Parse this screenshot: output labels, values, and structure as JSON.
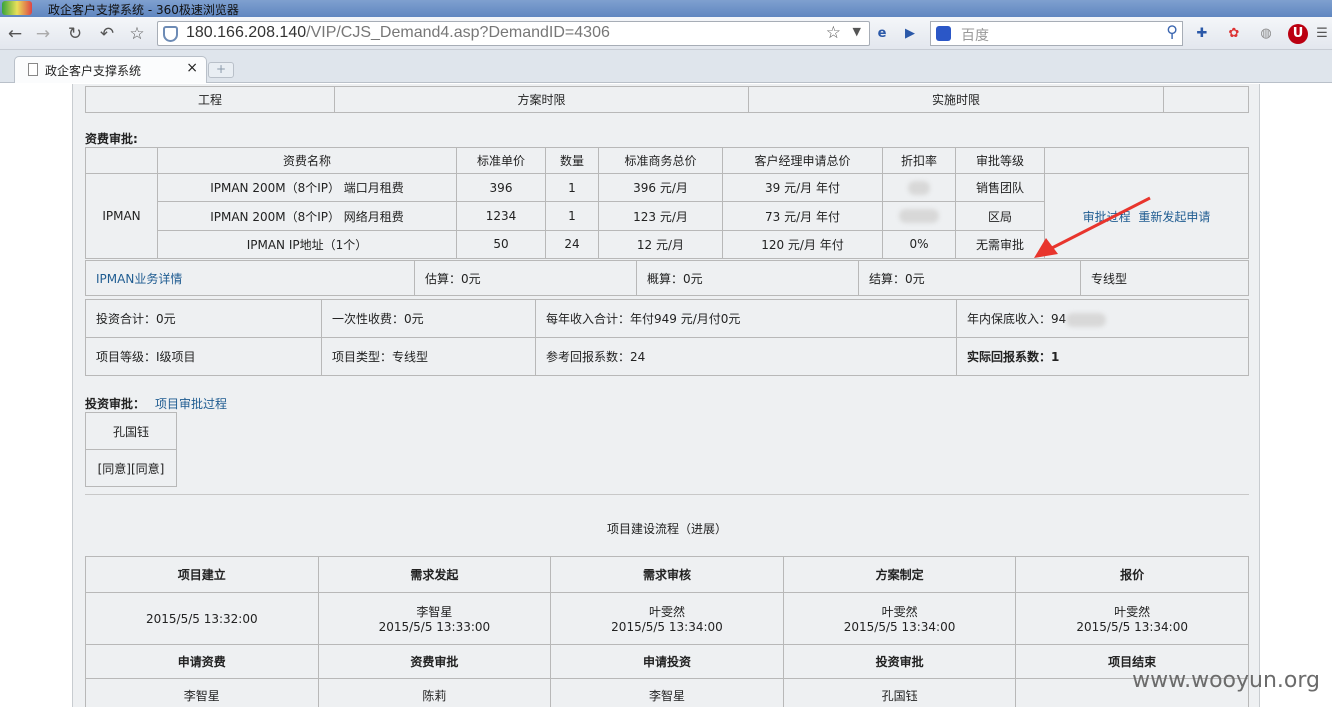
{
  "window": {
    "title": "政企客户支撑系统 - 360极速浏览器"
  },
  "toolbar": {
    "url_host": "180.166.208.140",
    "url_path": "/VIP/CJS_Demand4.asp?DemandID=4306",
    "search_placeholder": "百度"
  },
  "tab": {
    "label": "政企客户支撑系统"
  },
  "top_row": [
    "工程",
    "方案时限",
    "实施时限"
  ],
  "fee": {
    "section_label": "资费审批:",
    "headers": [
      "资费名称",
      "标准单价",
      "数量",
      "标准商务总价",
      "客户经理申请总价",
      "折扣率",
      "审批等级"
    ],
    "group": "IPMAN",
    "rows": [
      {
        "name": "IPMAN 200M（8个IP） 端口月租费",
        "unit": "396",
        "qty": "1",
        "std_total": "396 元/月",
        "mgr_total": "39 元/月 年付",
        "discount": "",
        "level": "销售团队"
      },
      {
        "name": "IPMAN 200M（8个IP） 网络月租费",
        "unit": "1234",
        "qty": "1",
        "std_total": "123 元/月",
        "mgr_total": "73 元/月 年付",
        "discount": "",
        "level": "区局"
      },
      {
        "name": "IPMAN IP地址（1个）",
        "unit": "50",
        "qty": "24",
        "std_total": "12 元/月",
        "mgr_total": "120 元/月 年付",
        "discount": "0%",
        "level": "无需审批"
      }
    ],
    "link_process": "审批过程",
    "link_reapply": "重新发起申请"
  },
  "estimates": {
    "detail_link": "IPMAN业务详情",
    "estimate": "估算：0元",
    "budget": "概算：0元",
    "final": "结算：0元",
    "type": "专线型"
  },
  "summary": {
    "invest": "投资合计：0元",
    "onetime": "一次性收费：0元",
    "annual": "每年收入合计：年付949 元/月付0元",
    "floor": "年内保底收入：94",
    "level": "项目等级：Ⅰ级项目",
    "ptype": "项目类型：专线型",
    "ref": "参考回报系数：24",
    "actual": "实际回报系数：1"
  },
  "invest_approval": {
    "label": "投资审批：",
    "link": "项目审批过程",
    "approver": "孔国钰",
    "status": "[同意][同意]"
  },
  "process": {
    "title": "项目建设流程（进展）",
    "row1_heads": [
      "项目建立",
      "需求发起",
      "需求审核",
      "方案制定",
      "报价"
    ],
    "row1_vals": [
      [
        "",
        "2015/5/5 13:32:00"
      ],
      [
        "李智星",
        "2015/5/5 13:33:00"
      ],
      [
        "叶雯然",
        "2015/5/5 13:34:00"
      ],
      [
        "叶雯然",
        "2015/5/5 13:34:00"
      ],
      [
        "叶雯然",
        "2015/5/5 13:34:00"
      ]
    ],
    "row2_heads": [
      "申请资费",
      "资费审批",
      "申请投资",
      "投资审批",
      "项目结束"
    ],
    "row2_vals": [
      "李智星",
      "陈莉",
      "李智星",
      "孔国钰",
      ""
    ]
  },
  "watermark": "www.wooyun.org"
}
